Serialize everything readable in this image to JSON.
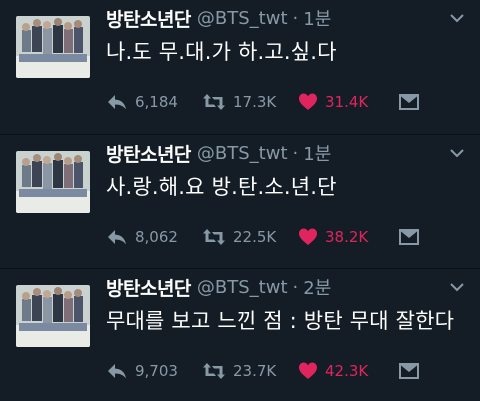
{
  "colors": {
    "background": "#141d26",
    "text": "#ffffff",
    "secondary": "#8899a6",
    "like_active": "#e0245e"
  },
  "tweets": [
    {
      "name": "방탄소년단",
      "handle": "@BTS_twt",
      "separator": "·",
      "time": "1분",
      "text": "나.도 무.대.가 하.고.싶.다",
      "replies": "6,184",
      "retweets": "17.3K",
      "likes": "31.4K"
    },
    {
      "name": "방탄소년단",
      "handle": "@BTS_twt",
      "separator": "·",
      "time": "1분",
      "text": "사.랑.해.요 방.탄.소.년.단",
      "replies": "8,062",
      "retweets": "22.5K",
      "likes": "38.2K"
    },
    {
      "name": "방탄소년단",
      "handle": "@BTS_twt",
      "separator": "·",
      "time": "2분",
      "text": "무대를 보고 느낀 점 : 방탄 무대 잘한다",
      "replies": "9,703",
      "retweets": "23.7K",
      "likes": "42.3K"
    }
  ],
  "icons": {
    "reply": "reply-icon",
    "retweet": "retweet-icon",
    "like": "heart-icon-filled",
    "dm": "envelope-icon",
    "more": "chevron-down-icon"
  }
}
